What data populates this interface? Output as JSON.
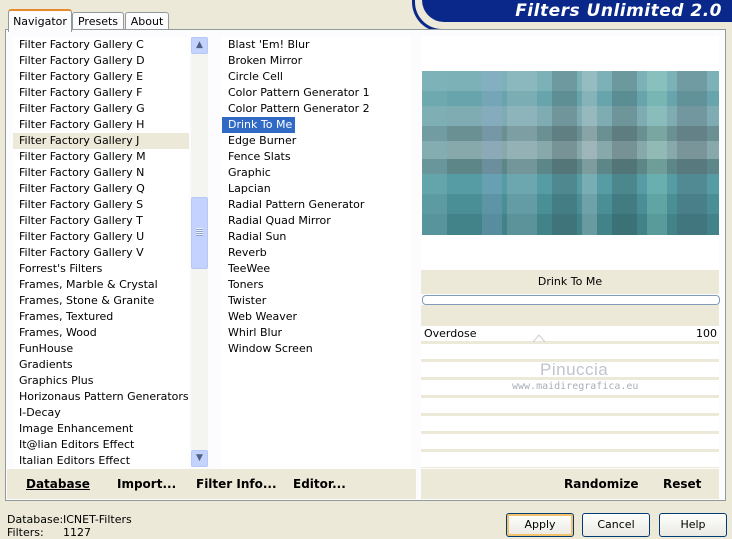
{
  "banner": {
    "title": "Filters Unlimited 2.0"
  },
  "tabs": [
    {
      "label": "Navigator",
      "active": true
    },
    {
      "label": "Presets",
      "active": false
    },
    {
      "label": "About",
      "active": false
    }
  ],
  "categories": [
    "Filter Factory Gallery C",
    "Filter Factory Gallery D",
    "Filter Factory Gallery E",
    "Filter Factory Gallery F",
    "Filter Factory Gallery G",
    "Filter Factory Gallery H",
    "Filter Factory Gallery J",
    "Filter Factory Gallery M",
    "Filter Factory Gallery N",
    "Filter Factory Gallery Q",
    "Filter Factory Gallery S",
    "Filter Factory Gallery T",
    "Filter Factory Gallery U",
    "Filter Factory Gallery V",
    "Forrest's Filters",
    "Frames, Marble & Crystal",
    "Frames, Stone & Granite",
    "Frames, Textured",
    "Frames, Wood",
    "FunHouse",
    "Gradients",
    "Graphics Plus",
    "Horizonaus Pattern Generators",
    "I-Decay",
    "Image Enhancement",
    "It@lian Editors Effect",
    "Italian Editors Effect"
  ],
  "selected_category": "Filter Factory Gallery J",
  "filters": [
    "Blast 'Em! Blur",
    "Broken Mirror",
    "Circle Cell",
    "Color Pattern Generator 1",
    "Color Pattern Generator 2",
    "Drink To Me",
    "Edge Burner",
    "Fence Slats",
    "Graphic",
    "Lapcian",
    "Radial Pattern Generator",
    "Radial Quad Mirror",
    "Radial Sun",
    "Reverb",
    "TeeWee",
    "Toners",
    "Twister",
    "Web Weaver",
    "Whirl Blur",
    "Window Screen"
  ],
  "selected_filter": "Drink To Me",
  "preview": {
    "filter_title": "Drink To Me"
  },
  "sliders": [
    {
      "label": "Overdose",
      "value": "100"
    }
  ],
  "watermark": {
    "name": "Pinuccia",
    "url": "www.maidiregrafica.eu"
  },
  "toolbar": {
    "database": "Database",
    "import": "Import...",
    "filter_info": "Filter Info...",
    "editor": "Editor...",
    "randomize": "Randomize",
    "reset": "Reset"
  },
  "status": {
    "database_label": "Database:",
    "database_value": "ICNET-Filters",
    "filters_label": "Filters:",
    "filters_value": "1127"
  },
  "buttons": {
    "apply": "Apply",
    "cancel": "Cancel",
    "help": "Help"
  },
  "colors": {
    "selection": "#316ac5",
    "banner": "#09288a",
    "teal": "#4aa6b0"
  }
}
